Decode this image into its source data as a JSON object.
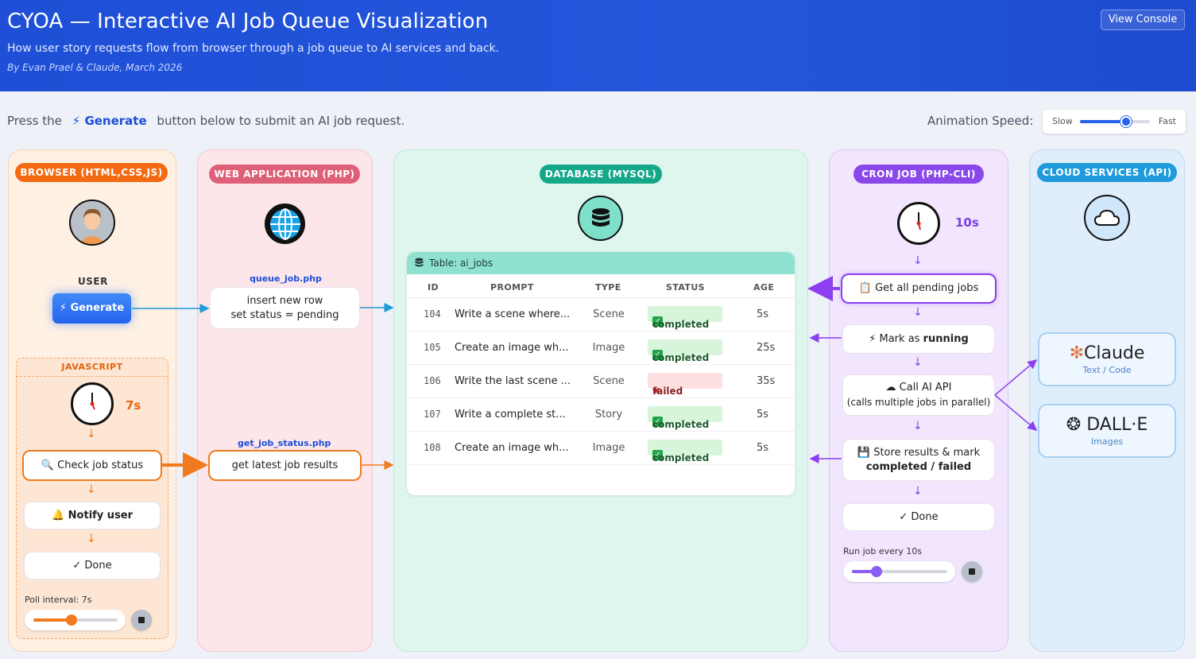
{
  "header": {
    "title": "CYOA — Interactive AI Job Queue Visualization",
    "subtitle": "How user story requests flow from browser through a job queue to AI services and back.",
    "byline": "By Evan Prael & Claude, March 2026",
    "console_button": "View Console"
  },
  "instruction": {
    "before": "Press the",
    "button": "Generate",
    "after": "button below to submit an AI job request."
  },
  "speed": {
    "label": "Animation Speed:",
    "slow": "Slow",
    "fast": "Fast",
    "level": 0.66
  },
  "columns": {
    "browser": "BROWSER (HTML,CSS,JS)",
    "webapp": "WEB APPLICATION (PHP)",
    "database": "DATABASE (MYSQL)",
    "cron": "CRON JOB (PHP-CLI)",
    "cloud": "CLOUD SERVICES (API)"
  },
  "browser": {
    "user_label": "USER",
    "generate_button": "Generate",
    "js_label": "JAVASCRIPT",
    "timer": "7s",
    "check_status": "Check job status",
    "notify": "Notify user",
    "done": "✓ Done",
    "poll_label": "Poll interval: 7s",
    "poll_level": 0.45
  },
  "webapp": {
    "queue_file": "queue_job.php",
    "queue_line1": "insert new row",
    "queue_line2": "set status = pending",
    "status_file": "get_job_status.php",
    "status_text": "get latest job results"
  },
  "database": {
    "table_title": "Table: ai_jobs",
    "headers": [
      "ID",
      "PROMPT",
      "TYPE",
      "STATUS",
      "AGE"
    ],
    "rows": [
      {
        "id": "104",
        "prompt": "Write a scene where...",
        "type": "Scene",
        "status": "completed",
        "age": "5s"
      },
      {
        "id": "105",
        "prompt": "Create an image wh...",
        "type": "Image",
        "status": "completed",
        "age": "25s"
      },
      {
        "id": "106",
        "prompt": "Write the last scene ...",
        "type": "Scene",
        "status": "failed",
        "age": "35s"
      },
      {
        "id": "107",
        "prompt": "Write a complete st...",
        "type": "Story",
        "status": "completed",
        "age": "5s"
      },
      {
        "id": "108",
        "prompt": "Create an image wh...",
        "type": "Image",
        "status": "completed",
        "age": "5s"
      }
    ]
  },
  "cron": {
    "timer": "10s",
    "get_pending": "Get all pending jobs",
    "mark_prefix": "Mark as",
    "mark_word": "running",
    "call_api": "Call AI API",
    "call_api_sub": "(calls multiple jobs in parallel)",
    "store_line1": "Store results & mark",
    "store_line2": "completed / failed",
    "done": "✓ Done",
    "run_label": "Run job every 10s",
    "run_level": 0.26
  },
  "cloud": {
    "claude_name": "Claude",
    "claude_sub": "Text / Code",
    "dalle_name": "DALL·E",
    "dalle_sub": "Images"
  }
}
